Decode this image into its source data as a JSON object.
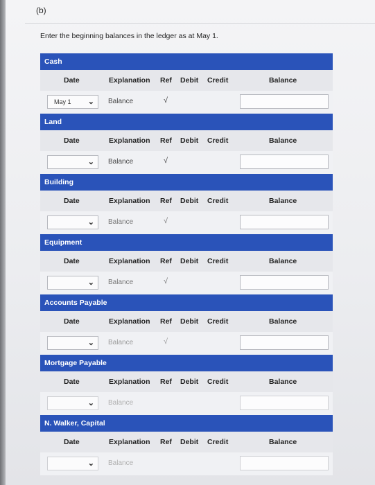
{
  "part_label": "(b)",
  "instruction": "Enter the beginning balances in the ledger as at May 1.",
  "columns": {
    "date": "Date",
    "explanation": "Explanation",
    "ref": "Ref",
    "debit": "Debit",
    "credit": "Credit",
    "balance": "Balance"
  },
  "accounts": [
    {
      "name": "Cash",
      "date_value": "May 1",
      "explanation": "Balance",
      "ref": "√",
      "balance_value": ""
    },
    {
      "name": "Land",
      "date_value": "",
      "explanation": "Balance",
      "ref": "√",
      "balance_value": ""
    },
    {
      "name": "Building",
      "date_value": "",
      "explanation": "Balance",
      "ref": "√",
      "balance_value": ""
    },
    {
      "name": "Equipment",
      "date_value": "",
      "explanation": "Balance",
      "ref": "√",
      "balance_value": ""
    },
    {
      "name": "Accounts Payable",
      "date_value": "",
      "explanation": "Balance",
      "ref": "√",
      "balance_value": ""
    },
    {
      "name": "Mortgage Payable",
      "date_value": "",
      "explanation": "Balance",
      "ref": "",
      "balance_value": ""
    },
    {
      "name": "N. Walker, Capital",
      "date_value": "",
      "explanation": "Balance",
      "ref": "",
      "balance_value": ""
    }
  ],
  "colors": {
    "header_blue": "#2a53b9"
  }
}
